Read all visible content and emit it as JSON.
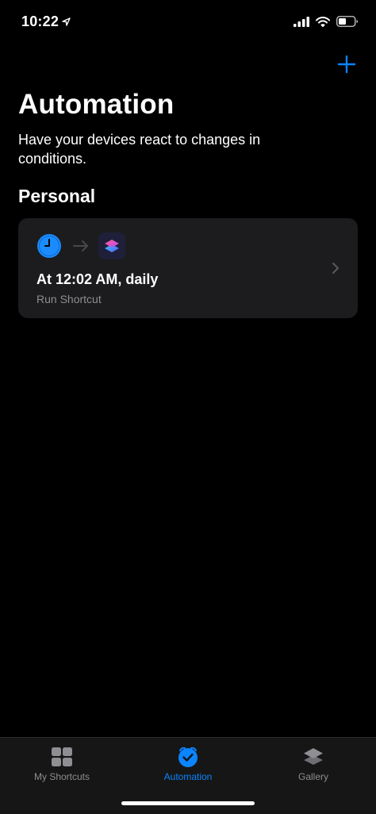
{
  "status_bar": {
    "time": "10:22",
    "icons": [
      "location-arrow-icon",
      "signal-bars-icon",
      "wifi-icon",
      "battery-icon"
    ]
  },
  "header": {
    "add_icon": "plus-icon",
    "title": "Automation",
    "subtitle": "Have your devices react to changes in conditions."
  },
  "section": {
    "title": "Personal"
  },
  "automation": {
    "trigger_icon": "clock-icon",
    "arrow_icon": "arrow-right-icon",
    "action_icon": "shortcuts-app-icon",
    "title": "At 12:02 AM, daily",
    "subtitle": "Run Shortcut",
    "chevron_icon": "chevron-right-icon"
  },
  "tab_bar": {
    "tabs": [
      {
        "label": "My Shortcuts",
        "icon": "grid-icon",
        "active": false
      },
      {
        "label": "Automation",
        "icon": "clock-check-icon",
        "active": true
      },
      {
        "label": "Gallery",
        "icon": "layers-icon",
        "active": false
      }
    ]
  },
  "colors": {
    "accent": "#0a84ff",
    "background": "#000000",
    "card": "#1c1c1e",
    "secondary_text": "#8e8e93"
  }
}
